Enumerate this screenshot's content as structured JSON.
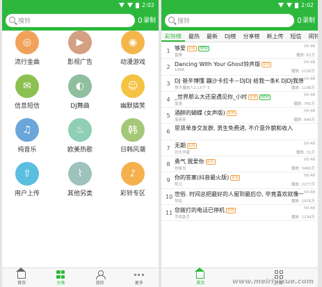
{
  "status_bar": {
    "time": "2:02"
  },
  "search": {
    "placeholder": "搜铃",
    "record_label": "录制"
  },
  "categories": [
    {
      "label": "流行金曲",
      "color": "#f0a25b",
      "icon": "globe-icon",
      "glyph": "◎"
    },
    {
      "label": "影视广告",
      "color": "#d4a083",
      "icon": "film-icon",
      "glyph": "▶"
    },
    {
      "label": "动漫游戏",
      "color": "#f4b64a",
      "icon": "gamepad-icon",
      "glyph": "◉"
    },
    {
      "label": "信息短信",
      "color": "#8cc152",
      "icon": "mail-icon",
      "glyph": "✉"
    },
    {
      "label": "DJ舞曲",
      "color": "#8fbf9e",
      "icon": "disc-icon",
      "glyph": "◐"
    },
    {
      "label": "幽默搞笑",
      "color": "#f5c343",
      "icon": "smile-icon",
      "glyph": "☺"
    },
    {
      "label": "纯音乐",
      "color": "#6aa6d9",
      "icon": "music-note-icon",
      "glyph": "♫"
    },
    {
      "label": "欧美热歌",
      "color": "#8fcfb5",
      "icon": "flame-icon",
      "glyph": "♨"
    },
    {
      "label": "日韩风潮",
      "color": "#a5c878",
      "icon": "korean-char-icon",
      "glyph": "韩"
    },
    {
      "label": "用户上传",
      "color": "#5bbde0",
      "icon": "upload-icon",
      "glyph": "⇧"
    },
    {
      "label": "其他另类",
      "color": "#9ec3bc",
      "icon": "paperclip-icon",
      "glyph": "⌇"
    },
    {
      "label": "彩铃专区",
      "color": "#f5b14e",
      "icon": "bell-icon",
      "glyph": "♪"
    }
  ],
  "left_nav": [
    {
      "label": "首页",
      "icon": "home-icon"
    },
    {
      "label": "分类",
      "icon": "category-icon"
    },
    {
      "label": "我的",
      "icon": "person-icon"
    },
    {
      "label": "更多",
      "icon": "more-icon"
    }
  ],
  "tabs": [
    "彩铃榜",
    "最热",
    "最新",
    "DJ榜",
    "分享榜",
    "新上传",
    "短信",
    "闹铃"
  ],
  "songs": [
    {
      "num": "1",
      "title": "够爱",
      "badges": [
        "彩铃",
        "NEW"
      ],
      "artist": "曾舜",
      "time": "00:48",
      "plays": "播放: 61万"
    },
    {
      "num": "2",
      "title": "Dancing With Your Ghost铃声版",
      "badges": [
        "彩铃"
      ],
      "artist": "1998",
      "time": "00:48",
      "plays": "播放: 2128万"
    },
    {
      "num": "3",
      "title": "DJ 爸辛博懂 蹦沙卡拉卡－DJDJ 给我一条K DJDJ我想要飞",
      "badges": [
        "彩铃"
      ],
      "artist": "快手播放人1:15个 5",
      "time": "00:48",
      "plays": "播放: 1198万"
    },
    {
      "num": "4",
      "title": "_世界那么大还是遇见你_小时",
      "badges": [
        "彩铃",
        "NEW"
      ],
      "artist": "加洛",
      "time": "00:48",
      "plays": "播放: 760万"
    },
    {
      "num": "5",
      "title": "酒醉的蝴蝶 (女声版)",
      "badges": [
        "彩铃"
      ],
      "artist": "海英芙",
      "time": "00:48",
      "plays": "播放: 949万"
    },
    {
      "num": "6",
      "title": "思贤单身交友群, 男生免费进, 不介意外貌和收入",
      "badges": [],
      "artist": "",
      "time": "",
      "plays": ""
    },
    {
      "num": "7",
      "title": "无期",
      "badges": [
        "彩铃"
      ],
      "artist": "光头华夏",
      "time": "00:48",
      "plays": "播放: 31万"
    },
    {
      "num": "8",
      "title": "勇气 我爱你",
      "badges": [
        "彩铃"
      ],
      "artist": "刘俊光",
      "time": "00:48",
      "plays": "播放: 3460万"
    },
    {
      "num": "9",
      "title": "你的答案(抖音最火版)",
      "badges": [
        "彩铃"
      ],
      "artist": "阿冗",
      "time": "00:48",
      "plays": "播放: 2277万"
    },
    {
      "num": "10",
      "title": "世俗. 时间总把最好的人留到最后😊, 毕竟喜欢就像一阵风😊, 而爱是细水长流😊",
      "badges": [
        "彩铃"
      ],
      "artist": "世俗",
      "time": "00:48",
      "plays": "播放: 1976万"
    },
    {
      "num": "11",
      "title": "您拨打的电话已停机",
      "badges": [
        "彩铃"
      ],
      "artist": "手机助手",
      "time": "00:48",
      "plays": "播放: 1234万"
    }
  ],
  "right_nav": [
    {
      "label": "首页",
      "icon": "home-icon"
    },
    {
      "label": "分类",
      "icon": "category-icon"
    }
  ],
  "watermark": "www.meiriyixue.com",
  "colors": {
    "brand_green": "#2db83d"
  }
}
